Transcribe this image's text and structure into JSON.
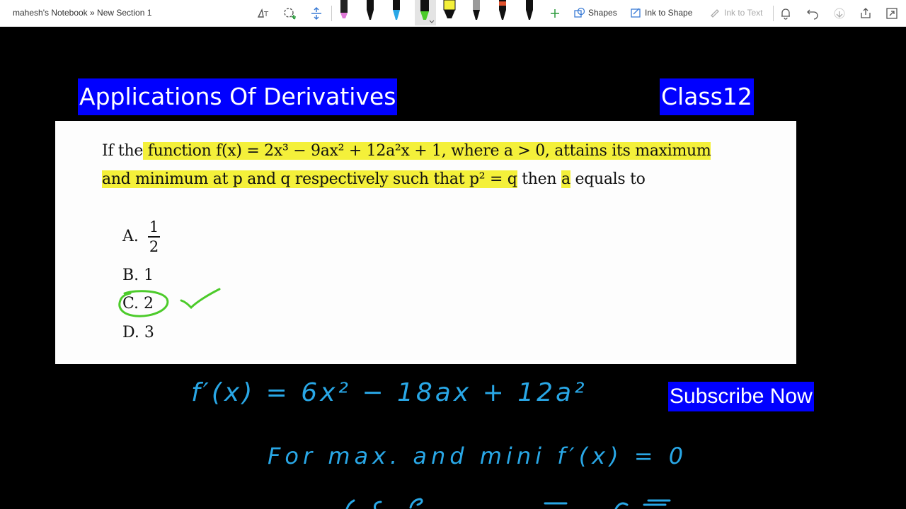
{
  "toolbar": {
    "breadcrumb": "mahesh's Notebook » New Section 1",
    "shapes_label": "Shapes",
    "ink_to_shape_label": "Ink to Shape",
    "ink_to_text_label": "Ink to Text",
    "pens": [
      {
        "color": "#222222",
        "tip": "#e07ad8"
      },
      {
        "color": "#111111",
        "tip": "#111111"
      },
      {
        "color": "#111111",
        "tip": "#29a7e6"
      },
      {
        "color": "#111111",
        "tip": "#4ccb2a",
        "selected": true
      },
      {
        "color": "#f4f03a",
        "tip": "#f4f03a"
      },
      {
        "color": "#111111",
        "tip": "#9a9a9a"
      },
      {
        "color": "#111111",
        "tip": "#e0522e"
      },
      {
        "color": "#111111",
        "tip": "#222222"
      }
    ]
  },
  "banners": {
    "title": "Applications Of Derivatives",
    "class": "Class12"
  },
  "question": {
    "line1_pre": "If the",
    "line1_hl": " function f(x) = 2x³ − 9ax² + 12a²x + 1",
    "line1_post": ", where a > 0, attains its maximum",
    "line2_hl": "and minimum at p and q respectively such that p² = q",
    "line2_mid": " then ",
    "line2_hl2": "a",
    "line2_post": " equals to",
    "options": [
      {
        "label": "A.",
        "num": "1",
        "den": "2"
      },
      {
        "label": "B.",
        "value": "1"
      },
      {
        "label": "C.",
        "value": "2"
      },
      {
        "label": "D.",
        "value": "3"
      }
    ]
  },
  "handwriting": {
    "line1": "f′(x) = 6x² − 18ax + 12a²",
    "line2": "For max. and mini   f′(x) = 0"
  },
  "subscribe_label": "Subscribe Now",
  "colors": {
    "banner": "#0000ff",
    "highlight": "#f4f03a",
    "ink_blue": "#29a7e6",
    "ink_green": "#4ccb2a"
  }
}
